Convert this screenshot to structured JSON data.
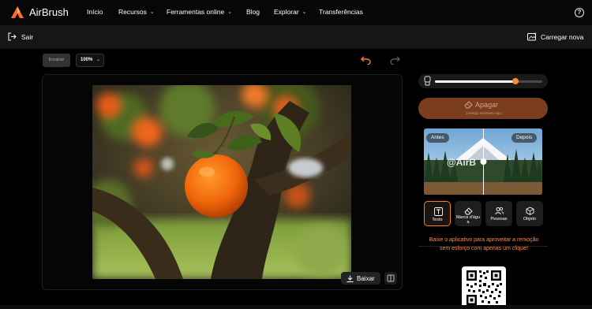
{
  "nav": {
    "brand": "AirBrush",
    "items": [
      {
        "label": "Início",
        "dropdown": false
      },
      {
        "label": "Recursos",
        "dropdown": true
      },
      {
        "label": "Ferramentas online",
        "dropdown": true
      },
      {
        "label": "Blog",
        "dropdown": false
      },
      {
        "label": "Explorar",
        "dropdown": true
      },
      {
        "label": "Transferências",
        "dropdown": false
      }
    ],
    "help": "?"
  },
  "toolbar": {
    "exit_label": "Sair",
    "upload_label": "Carregar nova"
  },
  "canvas": {
    "fit_label": "Encaixar",
    "zoom_value": "100%",
    "download_label": "Baixar"
  },
  "side": {
    "brush_size_level": 0.75,
    "erase_label": "Apagar",
    "erase_sub": "4 tempo estimado aqui",
    "before_label": "Antes",
    "after_label": "Depois",
    "watermark_text": "@AirB",
    "tools": [
      {
        "label": "Texto",
        "icon": "text-icon",
        "selected": true
      },
      {
        "label": "Marca d'águ a",
        "icon": "watermark-icon",
        "selected": false
      },
      {
        "label": "Pessoas",
        "icon": "people-icon",
        "selected": false
      },
      {
        "label": "Objeto",
        "icon": "object-icon",
        "selected": false
      }
    ],
    "promo": "Baixe o aplicativo para aproveitar a remoção sem esforço com apenas um clique!"
  },
  "colors": {
    "accent": "#ff7a33",
    "erase_button": "#7a3e1e",
    "nav_bg": "#070707"
  }
}
